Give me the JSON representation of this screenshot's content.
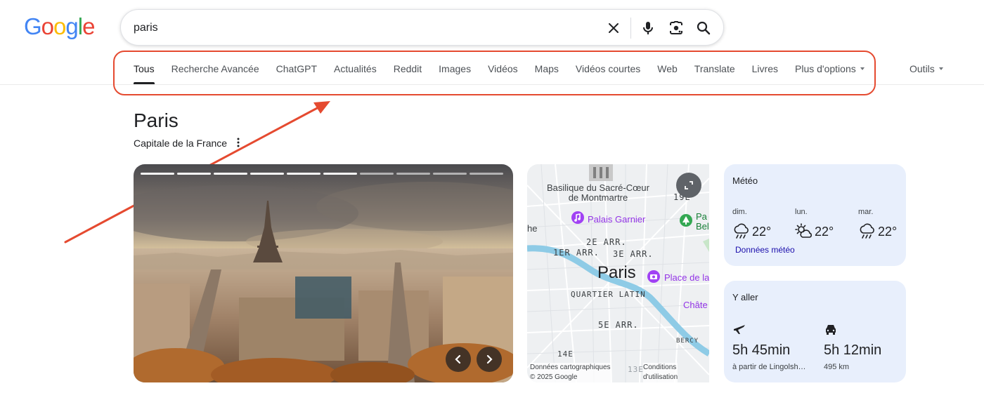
{
  "logo": {
    "text": "Google"
  },
  "search": {
    "query": "paris",
    "clear_icon": "close-icon",
    "voice_icon": "mic-icon",
    "lens_icon": "camera-icon",
    "search_icon": "search-icon"
  },
  "tabs": [
    {
      "label": "Tous",
      "active": true
    },
    {
      "label": "Recherche Avancée"
    },
    {
      "label": "ChatGPT"
    },
    {
      "label": "Actualités"
    },
    {
      "label": "Reddit"
    },
    {
      "label": "Images"
    },
    {
      "label": "Vidéos"
    },
    {
      "label": "Maps"
    },
    {
      "label": "Vidéos courtes"
    },
    {
      "label": "Web"
    },
    {
      "label": "Translate"
    },
    {
      "label": "Livres"
    },
    {
      "label": "Plus d'options"
    }
  ],
  "tools_label": "Outils",
  "annotation": {
    "color": "#e54a30"
  },
  "entity": {
    "title": "Paris",
    "subtitle": "Capitale de la France"
  },
  "photo": {
    "slide_count": 10,
    "active_slide": 6
  },
  "map": {
    "landmark": "Basilique du Sacré-Cœur de Montmartre",
    "landmark_line1": "Basilique du Sacré-Cœur",
    "landmark_line2": "de Montmartre",
    "arr_19": "19E",
    "poi_opera": "Palais Garnier",
    "poi_park": "Pa",
    "poi_park2": "Bel",
    "edge_left": "he",
    "arr_2": "2E ARR.",
    "arr_1": "1ER ARR.",
    "arr_3": "3E ARR.",
    "city": "Paris",
    "poi_vosges": "Place de la",
    "quartier": "QUARTIER LATIN",
    "poi_chateau": "Châte",
    "arr_5": "5E ARR.",
    "bercy": "BERCY",
    "arr_14": "14E",
    "arr_13": "13E",
    "footer_data": "Données cartographiques",
    "footer_copy": "© 2025 Google",
    "footer_terms1": "Conditions",
    "footer_terms2": "d'utilisation"
  },
  "weather": {
    "title": "Météo",
    "days": [
      {
        "label": "dim.",
        "temp": "22°",
        "icon": "rain-icon"
      },
      {
        "label": "lun.",
        "temp": "22°",
        "icon": "partly-sunny-icon"
      },
      {
        "label": "mar.",
        "temp": "22°",
        "icon": "rain-icon"
      }
    ],
    "link": "Données météo"
  },
  "travel": {
    "title": "Y aller",
    "modes": [
      {
        "icon": "plane-icon",
        "time": "5h 45min",
        "detail": "à partir de Lingolsh…"
      },
      {
        "icon": "car-icon",
        "time": "5h 12min",
        "detail": "495 km"
      }
    ]
  }
}
